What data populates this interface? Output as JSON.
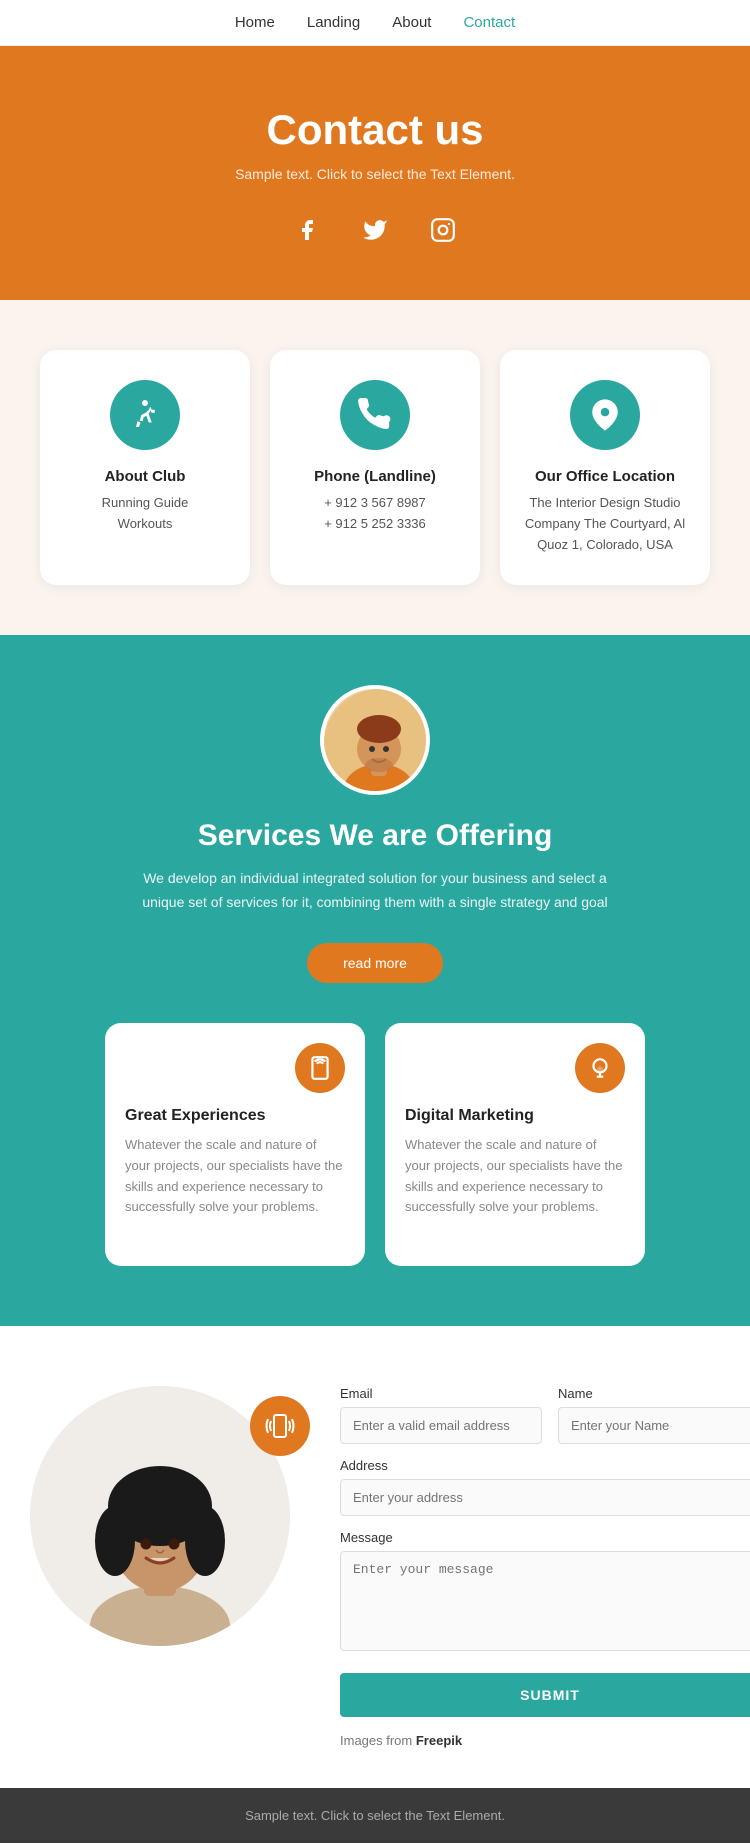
{
  "nav": {
    "items": [
      {
        "label": "Home",
        "active": false
      },
      {
        "label": "Landing",
        "active": false
      },
      {
        "label": "About",
        "active": false
      },
      {
        "label": "Contact",
        "active": true
      }
    ]
  },
  "hero": {
    "title": "Contact us",
    "subtitle": "Sample text. Click to select the Text Element.",
    "social": [
      "facebook",
      "twitter",
      "instagram"
    ]
  },
  "cards": [
    {
      "icon": "runner",
      "title": "About Club",
      "lines": [
        "Running Guide",
        "Workouts"
      ]
    },
    {
      "icon": "phone",
      "title": "Phone (Landline)",
      "lines": [
        "+ 912 3 567 8987",
        "+ 912 5 252 3336"
      ]
    },
    {
      "icon": "location",
      "title": "Our Office Location",
      "lines": [
        "The Interior Design Studio Company The Courtyard, Al Quoz 1, Colorado, USA"
      ]
    }
  ],
  "services": {
    "title": "Services We are Offering",
    "description": "We develop an individual integrated solution for your business and select a unique set of services for it, combining them with a single strategy and goal",
    "button_label": "read more",
    "cards": [
      {
        "icon": "mobile",
        "title": "Great Experiences",
        "description": "Whatever the scale and nature of your projects, our specialists have the skills and experience necessary to successfully solve your problems."
      },
      {
        "icon": "bulb",
        "title": "Digital Marketing",
        "description": "Whatever the scale and nature of your projects, our specialists have the skills and experience necessary to successfully solve your problems."
      }
    ]
  },
  "form": {
    "email_label": "Email",
    "email_placeholder": "Enter a valid email address",
    "name_label": "Name",
    "name_placeholder": "Enter your Name",
    "address_label": "Address",
    "address_placeholder": "Enter your address",
    "message_label": "Message",
    "message_placeholder": "Enter your message",
    "submit_label": "SUBMIT",
    "image_credit": "Images from ",
    "image_credit_link": "Freepik"
  },
  "footer": {
    "text": "Sample text. Click to select the Text Element."
  },
  "colors": {
    "orange": "#e07820",
    "teal": "#2aa8a0",
    "bg_light": "#faf3ee"
  }
}
